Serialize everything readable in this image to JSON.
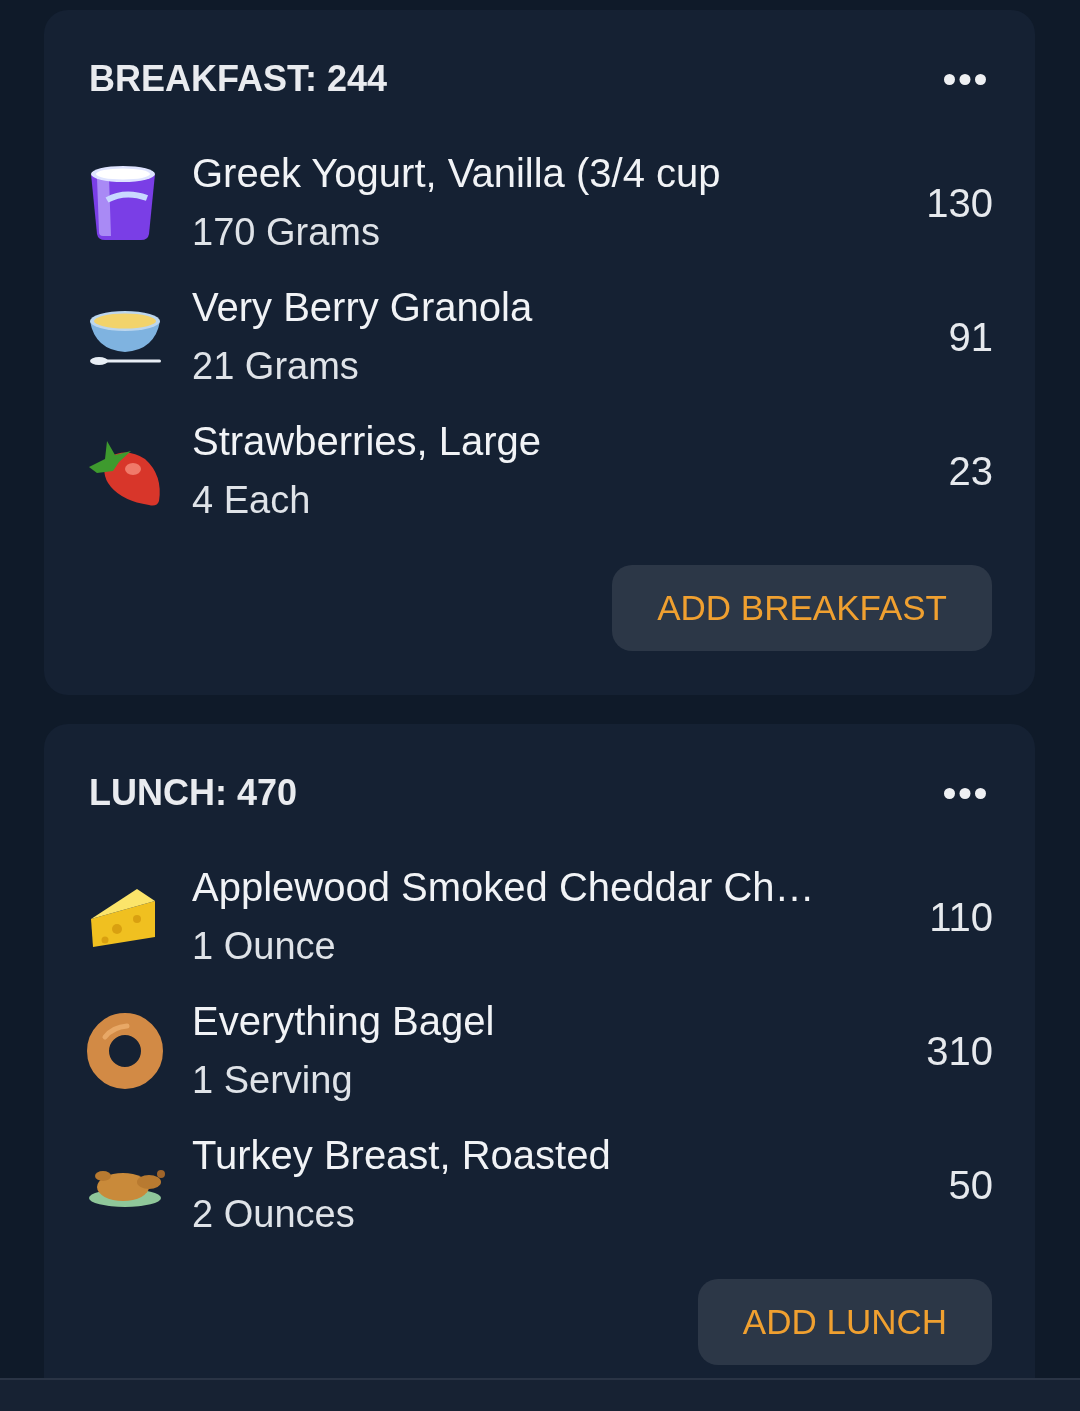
{
  "sections": [
    {
      "title": "BREAKFAST: 244",
      "items": [
        {
          "name": "Greek Yogurt, Vanilla (3/4 cup",
          "amount": "170 Grams",
          "calories": "130"
        },
        {
          "name": "Very Berry Granola",
          "amount": "21 Grams",
          "calories": "91"
        },
        {
          "name": "Strawberries, Large",
          "amount": "4 Each",
          "calories": "23"
        }
      ],
      "button": "ADD BREAKFAST"
    },
    {
      "title": "LUNCH: 470",
      "items": [
        {
          "name": "Applewood Smoked Cheddar Ch…",
          "amount": "1 Ounce",
          "calories": "110"
        },
        {
          "name": "Everything Bagel",
          "amount": "1 Serving",
          "calories": "310"
        },
        {
          "name": "Turkey Breast, Roasted",
          "amount": "2 Ounces",
          "calories": "50"
        }
      ],
      "button": "ADD LUNCH"
    }
  ]
}
